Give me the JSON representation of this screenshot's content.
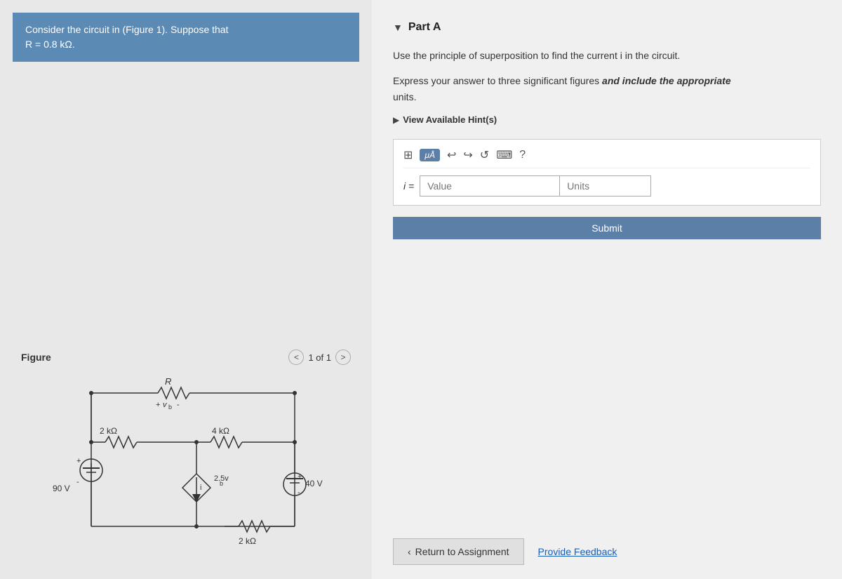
{
  "left_panel": {
    "problem_text_1": "Consider the circuit in (Figure 1). Suppose that",
    "problem_text_2": "R = 0.8 kΩ.",
    "figure_label": "Figure",
    "pagination": "1 of 1"
  },
  "right_panel": {
    "part_label": "Part A",
    "question_line1": "Use the principle of superposition to find the current i in the circuit.",
    "question_line2_prefix": "Express your answer to three significant figures ",
    "question_line2_bold": "and include the appropriate",
    "question_line3": "units.",
    "hint_text": "View Available Hint(s)",
    "mu_a": "μÅ",
    "i_label": "i =",
    "value_placeholder": "Value",
    "units_placeholder": "Units",
    "submit_label": "Submit",
    "return_label": "Return to Assignment",
    "feedback_label": "Provide Feedback"
  },
  "toolbar_icons": {
    "grid": "⊞",
    "undo": "↩",
    "redo": "↪",
    "refresh": "↺",
    "keyboard": "⌨",
    "help": "?"
  }
}
